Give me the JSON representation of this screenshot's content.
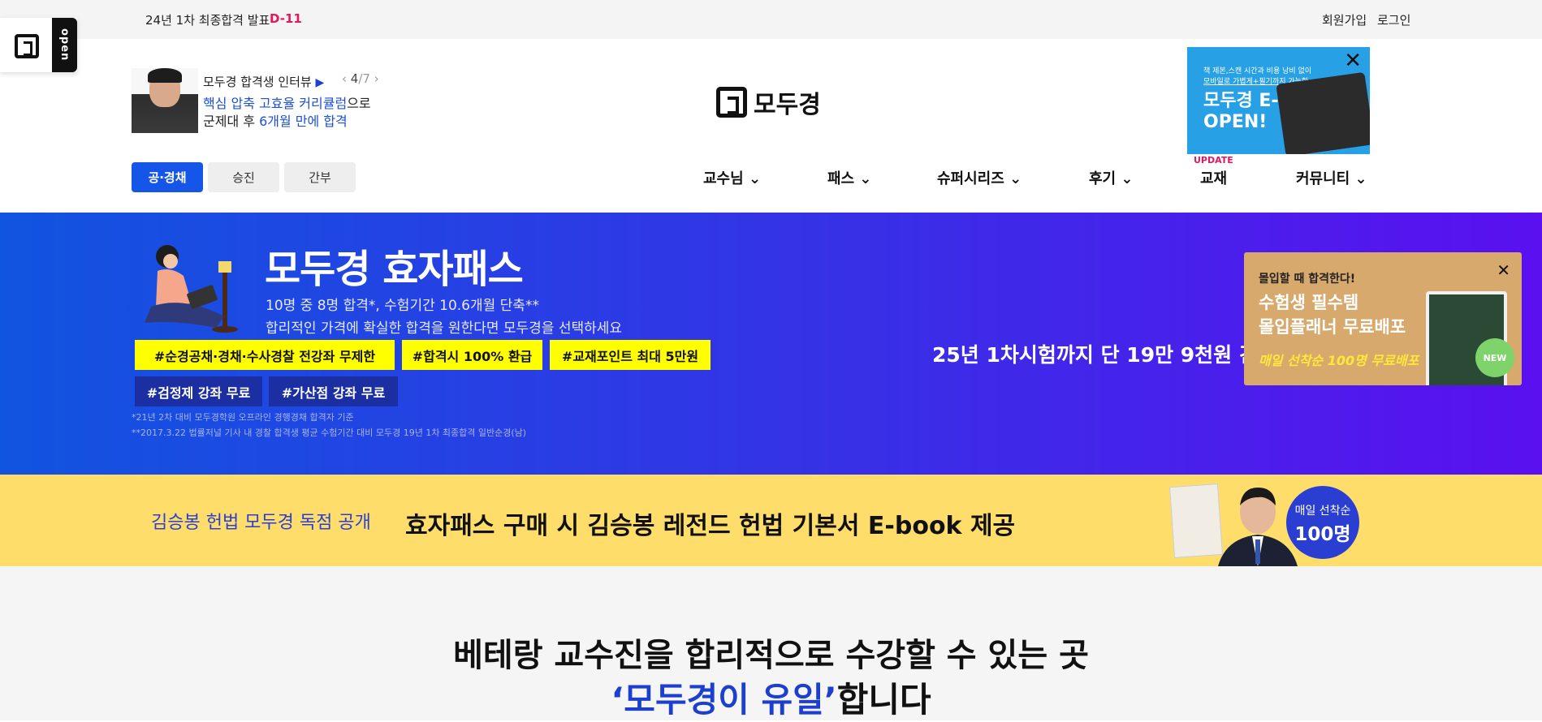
{
  "topbar": {
    "notice": "24년 1차 최종합격 발표",
    "dday": "D-11",
    "join": "회원가입",
    "login": "로그인"
  },
  "open_badge": {
    "label": "open"
  },
  "interview": {
    "title": "모두경 합격생 인터뷰",
    "play": "▶",
    "page_current": "4",
    "page_total": "/7",
    "line1_highlight": "핵심 압축 고효율 커리큘럼",
    "line1_rest": "으로",
    "line2_prefix": "군제대 후 ",
    "line2_highlight": "6개월 만에 합격"
  },
  "logo": {
    "text": "모두경"
  },
  "ebook_ad": {
    "small1": "책 제본,스캔 시간과 비용 낭비 없이",
    "small2": "모바일로 가볍게+필기까지 가능한",
    "title1": "모두경 E-BOOK",
    "title2": "OPEN!",
    "close": "✕"
  },
  "category_tabs": [
    "공·경채",
    "승진",
    "간부"
  ],
  "gnb": {
    "items": [
      "교수님",
      "패스",
      "슈퍼시리즈",
      "후기",
      "교재",
      "커뮤니티"
    ],
    "update_label": "UPDATE"
  },
  "hero": {
    "title": "모두경 효자패스",
    "sub1": "10명 중 8명 합격*, 수험기간 10.6개월 단축**",
    "sub2": "합리적인 가격에 확실한 합격을 원한다면 모두경을 선택하세요",
    "tags": [
      "#순경공채·경채·수사경찰 전강좌 무제한",
      "#합격시 100% 환급",
      "#교재포인트 최대 5만원"
    ],
    "tags2": [
      "#검정제 강좌 무료",
      "#가산점 강좌 무료"
    ],
    "footnote1": "*21년 2차 대비 모두경학원 오프라인 경행경채 합격자 기준",
    "footnote2": "**2017.3.22 법률저널 기사 내 경찰 합격생 평균 수험기간 대비 모두경 19년 1차 최종합격 일반순경(남)",
    "promo": "25년 1차시험까지 단 19만 9천원 긴"
  },
  "planner_popup": {
    "line1": "몰입할 때 합격한다!",
    "line2": "수험생 필수템",
    "line3": "몰입플래너 무료배포",
    "line4": "매일 선착순 100명 무료배포",
    "badge": "NEW",
    "close": "✕"
  },
  "yellow_band": {
    "left": "김승봉 헌법 모두경 독점 공개",
    "main": "효자패스 구매 시 김승봉 레전드 헌법 기본서 E-book 제공",
    "circle1": "매일 선착순",
    "circle2": "100명"
  },
  "lower": {
    "line1": "베테랑 교수진을 합리적으로 수강할 수 있는 곳",
    "line2_highlight": "‘모두경이 유일’",
    "line2_rest": "합니다"
  }
}
